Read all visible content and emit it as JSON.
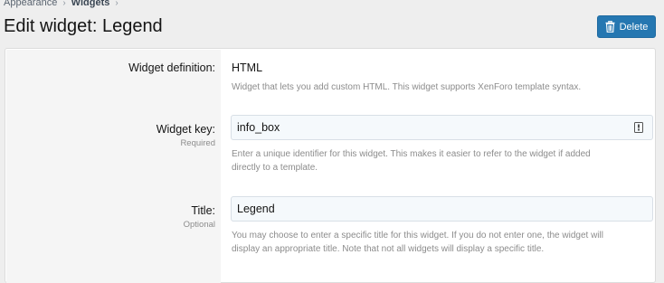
{
  "breadcrumb": {
    "items": [
      "Appearance",
      "Widgets"
    ],
    "separator": "›"
  },
  "page": {
    "title": "Edit widget: Legend"
  },
  "toolbar": {
    "delete_label": "Delete",
    "delete_icon": "trash-icon",
    "accent_color": "#2577b1"
  },
  "form": {
    "definition": {
      "label": "Widget definition:",
      "value": "HTML",
      "explain": "Widget that lets you add custom HTML. This widget supports XenForo template syntax."
    },
    "widget_key": {
      "label": "Widget key:",
      "hint": "Required",
      "value": "info_box",
      "icon": "password-manager-icon",
      "explain_line1": "Enter a unique identifier for this widget. This makes it easier to refer to the widget if added",
      "explain_line2": "directly to a template."
    },
    "title": {
      "label": "Title:",
      "hint": "Optional",
      "value": "Legend",
      "explain_line1": "You may choose to enter a specific title for this widget. If you do not enter one, the widget will",
      "explain_line2": "display an appropriate title. Note that not all widgets will display a specific title."
    }
  }
}
